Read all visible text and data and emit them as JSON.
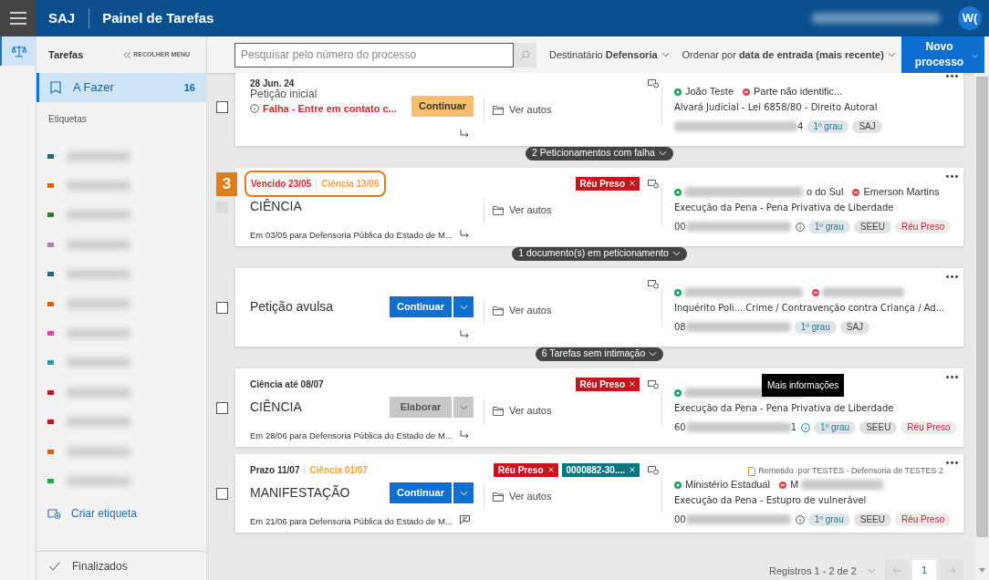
{
  "header": {
    "logo": "SAJ",
    "title": "Painel de Tarefas",
    "avatar": "W("
  },
  "sidebar": {
    "title": "Tarefas",
    "collapse": "RECOLHER MENU",
    "items": [
      {
        "label": "A Fazer",
        "count": "16",
        "selected": true
      }
    ],
    "section": "Etiquetas",
    "tags": [
      {
        "color": "#1e6b7b"
      },
      {
        "color": "#e8590c"
      },
      {
        "color": "#2e7d32"
      },
      {
        "color": "#b57bb5"
      },
      {
        "color": "#1e6b7b"
      },
      {
        "color": "#e8590c"
      },
      {
        "color": "#e83ea8"
      },
      {
        "color": "#1fa0b0"
      },
      {
        "color": "#b71c1c"
      },
      {
        "color": "#b71c1c"
      },
      {
        "color": "#e8590c"
      },
      {
        "color": "#22a845"
      }
    ],
    "create_label": "Criar etiqueta",
    "footer": "Finalizados"
  },
  "toolbar": {
    "search": {
      "placeholder": "Pesquisar pelo número do processo"
    },
    "recipient_label": "Destinatário",
    "recipient_value": "Defensoria",
    "sort_label": "Ordenar por",
    "sort_value": "data de entrada (mais recente)",
    "new_button": "Novo processo"
  },
  "cards": [
    {
      "checkbox": {
        "checked": false,
        "disabled": false
      },
      "dates": [
        {
          "text": "28 Jun. 24",
          "kind": "plain"
        }
      ],
      "title": {
        "text": "Petição inicial",
        "kind": "subtle"
      },
      "error": "Falha - Entre em contato c...",
      "bottom_icon": {
        "kind": "reply"
      },
      "action": {
        "label": "Continuar",
        "kind": "warning",
        "split": false
      },
      "link": "Ver autos",
      "parties": [
        {
          "kind": "active",
          "after": "João Teste",
          "redacted": false
        },
        {
          "kind": "blocked",
          "after": "Parte não identific...",
          "redacted": false
        }
      ],
      "subject": "Alvará Judicial - Lei 6858/80 - Direito Autoral",
      "number": {
        "after": "4"
      },
      "info": false,
      "badges": [
        {
          "label": "1º grau",
          "kind": "grade"
        },
        {
          "label": "SAJ",
          "kind": "system"
        }
      ],
      "group_after": "2 Peticionamentos com falha"
    },
    {
      "checkbox": {
        "checked": false,
        "disabled": true
      },
      "callout": "3",
      "dates": [
        {
          "text": "Vencido 23/05",
          "kind": "overdue"
        },
        {
          "text": "Ciência 13/05",
          "kind": "science"
        }
      ],
      "chips": [
        {
          "label": "Réu Preso",
          "kind": "red"
        }
      ],
      "title": {
        "text": "CIÊNCIA",
        "kind": "large"
      },
      "note": "Em 03/05 para Defensoria Pública do Estado de M...",
      "bottom_icon": {
        "kind": "reply"
      },
      "link": "Ver autos",
      "parties": [
        {
          "kind": "active",
          "after": "o do Sul",
          "redacted": true
        },
        {
          "kind": "blocked",
          "after": "Emerson Martins",
          "redacted": false
        }
      ],
      "subject": "Execução da Pena - Pena Privativa de Liberdade",
      "number": {
        "before": "00"
      },
      "info": true,
      "badges": [
        {
          "label": "1º grau",
          "kind": "grade"
        },
        {
          "label": "SEEU",
          "kind": "system"
        },
        {
          "label": "Réu Preso",
          "kind": "alert"
        }
      ],
      "group_after": "1 documento(s) em peticionamento"
    },
    {
      "checkbox": {
        "checked": false,
        "disabled": false
      },
      "title": {
        "text": "Petição avulsa",
        "kind": "large"
      },
      "bottom_icon": {
        "kind": "reply"
      },
      "action": {
        "label": "Continuar",
        "kind": "primary",
        "split": true
      },
      "link": "Ver autos",
      "parties": [
        {
          "kind": "active",
          "redacted": true
        },
        {
          "kind": "blocked",
          "redacted": true
        }
      ],
      "subject": "Inquérito Poli...  Crime / Contravenção contra Criança / Ad...",
      "number": {
        "before": "08"
      },
      "info": false,
      "badges": [
        {
          "label": "1º grau",
          "kind": "grade"
        },
        {
          "label": "SAJ",
          "kind": "system"
        }
      ],
      "group_after": "6 Tarefas sem intimação"
    },
    {
      "checkbox": {
        "checked": false,
        "disabled": false
      },
      "dates": [
        {
          "text": "Ciência até 08/07",
          "kind": "plain"
        }
      ],
      "chips": [
        {
          "label": "Réu Preso",
          "kind": "red"
        }
      ],
      "title": {
        "text": "CIÊNCIA",
        "kind": "large"
      },
      "note": "Em 28/06 para Defensoria Pública do Estado de M...",
      "bottom_icon": {
        "kind": "reply"
      },
      "action": {
        "label": "Elaborar",
        "kind": "disabled",
        "split": true
      },
      "link": "Ver autos",
      "parties": [
        {
          "kind": "active",
          "redacted": true
        }
      ],
      "tooltip": "Mais informações",
      "subject": "Execução da Pena - Pena Privativa de Liberdade",
      "number": {
        "before": "60",
        "after": "1"
      },
      "info": true,
      "badges": [
        {
          "label": "1º grau",
          "kind": "grade"
        },
        {
          "label": "SEEU",
          "kind": "system"
        },
        {
          "label": "Réu Preso",
          "kind": "alert"
        }
      ]
    },
    {
      "checkbox": {
        "checked": false,
        "disabled": false
      },
      "dates": [
        {
          "text": "Prazo 11/07",
          "kind": "plain"
        },
        {
          "text": "Ciência 01/07",
          "kind": "science"
        }
      ],
      "chips": [
        {
          "label": "Réu Preso",
          "kind": "red"
        },
        {
          "label": "0000882-30....",
          "kind": "teal"
        }
      ],
      "title": {
        "text": "MANIFESTAÇÃO",
        "kind": "large"
      },
      "note": "Em 21/06 para Defensoria Pública do Estado de M...",
      "bottom_icon": {
        "kind": "comment"
      },
      "action": {
        "label": "Continuar",
        "kind": "primary",
        "split": true
      },
      "link": "Ver autos",
      "remitted": {
        "label": "Remetido",
        "by": "por TESTES - Defensoria de TESTES 2"
      },
      "parties": [
        {
          "kind": "active",
          "after": "Ministério Estadual",
          "redacted": false
        },
        {
          "kind": "blocked",
          "before": "M",
          "redacted": true
        }
      ],
      "subject": "Execução da Pena - Estupro de vulnerável",
      "number": {
        "before": "00"
      },
      "info": true,
      "badges": [
        {
          "label": "1º grau",
          "kind": "grade"
        },
        {
          "label": "SEEU",
          "kind": "system"
        },
        {
          "label": "Réu Preso",
          "kind": "alert"
        }
      ]
    }
  ],
  "pagination": {
    "summary": "Registros 1 - 2 de 2",
    "pages": [
      {
        "label": "1",
        "selected": true
      }
    ]
  }
}
